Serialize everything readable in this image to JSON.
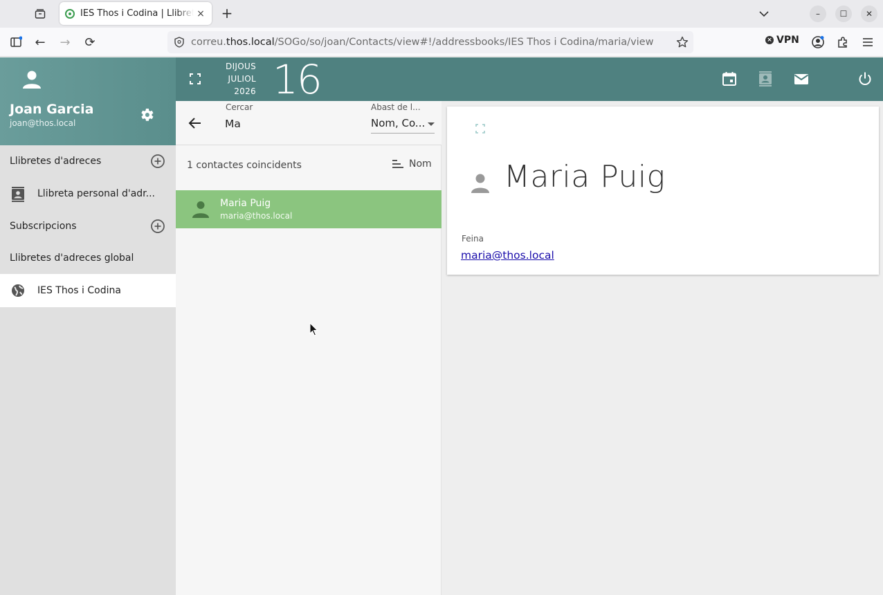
{
  "browser": {
    "tab_title": "IES Thos i Codina | Llibreta d'adreces",
    "tab_close": "×",
    "new_tab": "+",
    "url_prefix": "correu.",
    "url_domain": "thos.local",
    "url_path": "/SOGo/so/joan/Contacts/view#!/addressbooks/IES Thos i Codina/maria/view",
    "vpn_label": "VPN",
    "vpn_status": "×",
    "icons": {
      "back": "←",
      "forward": "→",
      "reload": "⟳",
      "minimize": "–",
      "maximize": "☐",
      "close": "✕"
    }
  },
  "user": {
    "name": "Joan Garcia",
    "email": "joan@thos.local"
  },
  "sidebar": {
    "addressbooks_header": "Llibretes d'adreces",
    "personal_addressbook": "Llibreta personal d'adr...",
    "subscriptions_header": "Subscripcions",
    "global_header": "Llibretes d'adreces global",
    "global_item": "IES Thos i Codina"
  },
  "header": {
    "day_name": "DIJOUS",
    "month": "JULIOL",
    "year": "2026",
    "day": "16"
  },
  "search": {
    "label": "Cercar",
    "value": "Ma",
    "scope_label": "Abast de l...",
    "scope_value": "Nom, Co..."
  },
  "list": {
    "count_text": "1 contactes coincidents",
    "sort_label": "Nom",
    "items": [
      {
        "name": "Maria Puig",
        "email": "maria@thos.local"
      }
    ]
  },
  "contact": {
    "name": "Maria Puig",
    "email_label": "Feina",
    "email": "maria@thos.local"
  },
  "colors": {
    "header_teal": "#4f8180",
    "user_teal": "#6a9d9b",
    "selected_green": "#8bc57f",
    "link_blue": "#1a0dab"
  }
}
